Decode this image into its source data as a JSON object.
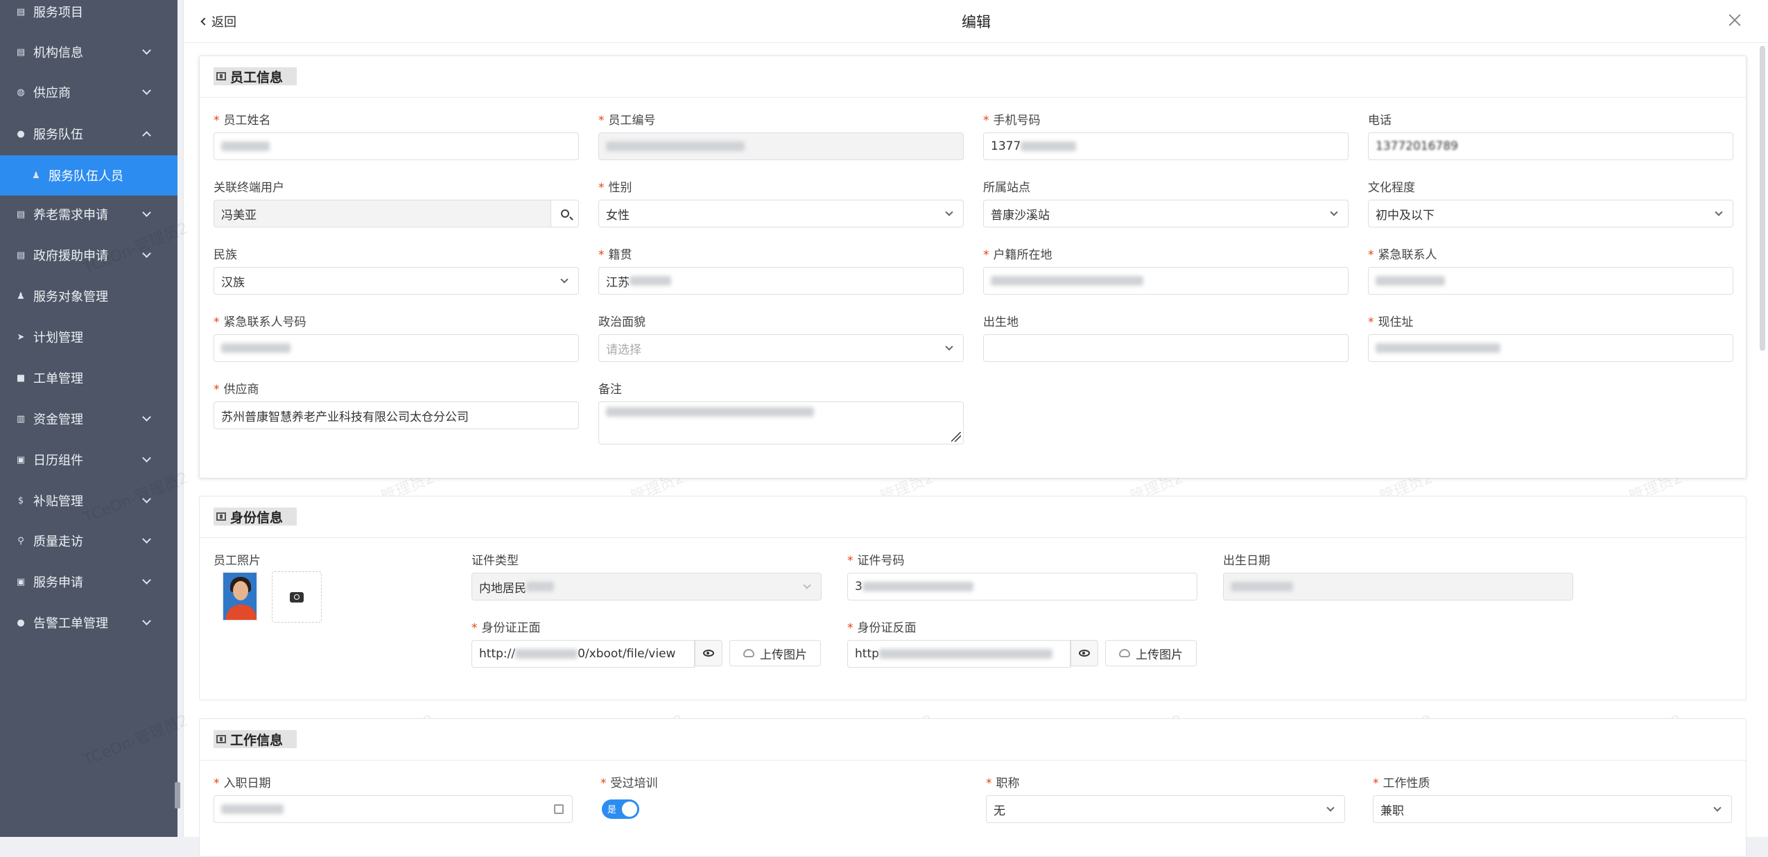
{
  "sidebar": {
    "items": [
      {
        "label": "服务项目",
        "icon": "doc-icon"
      },
      {
        "label": "机构信息",
        "icon": "doc-icon"
      },
      {
        "label": "供应商",
        "icon": "globe-icon"
      },
      {
        "label": "服务队伍",
        "icon": "team-icon"
      },
      {
        "label": "服务队伍人员",
        "icon": "person-icon"
      },
      {
        "label": "养老需求申请",
        "icon": "doc-icon"
      },
      {
        "label": "政府援助申请",
        "icon": "doc-icon"
      },
      {
        "label": "服务对象管理",
        "icon": "person-icon"
      },
      {
        "label": "计划管理",
        "icon": "send-icon"
      },
      {
        "label": "工单管理",
        "icon": "list-icon"
      },
      {
        "label": "资金管理",
        "icon": "fund-icon"
      },
      {
        "label": "日历组件",
        "icon": "calendar-icon"
      },
      {
        "label": "补贴管理",
        "icon": "dollar-icon"
      },
      {
        "label": "质量走访",
        "icon": "walk-icon"
      },
      {
        "label": "服务申请",
        "icon": "calendar-icon"
      },
      {
        "label": "告警工单管理",
        "icon": "alert-icon"
      }
    ]
  },
  "topbar": {
    "back": "返回",
    "title": "编辑"
  },
  "watermark": "TCeOn-管理员2",
  "employee": {
    "title": "员工信息",
    "name_label": "员工姓名",
    "no_label": "员工编号",
    "mobile_label": "手机号码",
    "mobile_value": "1377",
    "phone_label": "电话",
    "phone_value": "13772016789",
    "user_label": "关联终端用户",
    "user_value": "冯美亚",
    "gender_label": "性别",
    "gender_value": "女性",
    "station_label": "所属站点",
    "station_value": "普康沙溪站",
    "edu_label": "文化程度",
    "edu_value": "初中及以下",
    "nation_label": "民族",
    "nation_value": "汉族",
    "native_label": "籍贯",
    "native_value": "江苏",
    "hukou_label": "户籍所在地",
    "contact_label": "紧急联系人",
    "contact_phone_label": "紧急联系人号码",
    "politics_label": "政治面貌",
    "politics_placeholder": "请选择",
    "birthplace_label": "出生地",
    "address_label": "现住址",
    "supplier_label": "供应商",
    "supplier_value": "苏州普康智慧养老产业科技有限公司太仓分公司",
    "remark_label": "备注"
  },
  "identity": {
    "title": "身份信息",
    "photo_label": "员工照片",
    "idtype_label": "证件类型",
    "idtype_value": "内地居民",
    "idno_label": "证件号码",
    "idno_value": "3",
    "birthdate_label": "出生日期",
    "front_label": "身份证正面",
    "front_value": "http://",
    "front_value2": "0/xboot/file/view",
    "back_label": "身份证反面",
    "back_value": "http",
    "upload_label": "上传图片"
  },
  "work": {
    "title": "工作信息",
    "entry_label": "入职日期",
    "trained_label": "受过培训",
    "trained_value": "是",
    "jobtitle_label": "职称",
    "jobtitle_value": "无",
    "nature_label": "工作性质",
    "nature_value": "兼职"
  }
}
